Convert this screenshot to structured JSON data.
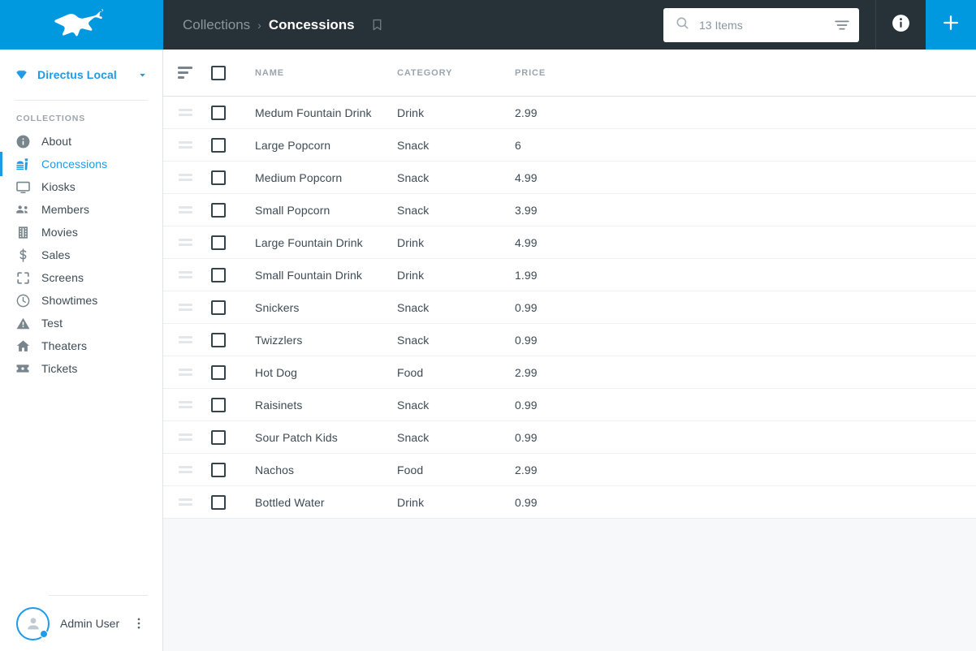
{
  "theme": {
    "brand_blue": "#0099e0",
    "accent_blue": "#1d9ae8",
    "header_dark": "#263238",
    "text_primary": "#3d4b55",
    "text_muted": "#9aa5ad",
    "page_bg": "#f7f8f9"
  },
  "sidebar": {
    "logo_icon": "directus-rabbit-logo",
    "project": {
      "icon": "gem-icon",
      "name": "Directus Local",
      "caret_icon": "chevron-down-icon"
    },
    "section_label": "COLLECTIONS",
    "items": [
      {
        "label": "About",
        "icon": "info-circle-icon",
        "active": false
      },
      {
        "label": "Concessions",
        "icon": "fastfood-icon",
        "active": true
      },
      {
        "label": "Kiosks",
        "icon": "monitor-icon",
        "active": false
      },
      {
        "label": "Members",
        "icon": "people-icon",
        "active": false
      },
      {
        "label": "Movies",
        "icon": "film-strip-icon",
        "active": false
      },
      {
        "label": "Sales",
        "icon": "dollar-sign-icon",
        "active": false
      },
      {
        "label": "Screens",
        "icon": "fullscreen-icon",
        "active": false
      },
      {
        "label": "Showtimes",
        "icon": "clock-icon",
        "active": false
      },
      {
        "label": "Test",
        "icon": "warning-triangle-icon",
        "active": false
      },
      {
        "label": "Theaters",
        "icon": "home-icon",
        "active": false
      },
      {
        "label": "Tickets",
        "icon": "ticket-icon",
        "active": false
      }
    ],
    "user": {
      "name": "Admin User",
      "avatar_icon": "person-avatar-icon",
      "status": "online",
      "menu_icon": "more-vertical-icon"
    }
  },
  "header": {
    "breadcrumb_parent": "Collections",
    "breadcrumb_separator": "›",
    "title": "Concessions",
    "bookmark_icon": "bookmark-icon",
    "search": {
      "icon": "search-icon",
      "placeholder": "13 Items",
      "value": "",
      "filter_icon": "filter-icon"
    },
    "info_button": {
      "icon": "info-icon",
      "label": "Info"
    },
    "add_button": {
      "icon": "plus-icon",
      "label": "Create Item"
    }
  },
  "table": {
    "sort_icon": "sort-icon",
    "select_all_checked": false,
    "columns": [
      {
        "key": "name",
        "label": "NAME"
      },
      {
        "key": "category",
        "label": "CATEGORY"
      },
      {
        "key": "price",
        "label": "PRICE"
      }
    ],
    "rows": [
      {
        "name": "Medum Fountain Drink",
        "category": "Drink",
        "price": "2.99"
      },
      {
        "name": "Large Popcorn",
        "category": "Snack",
        "price": "6"
      },
      {
        "name": "Medium Popcorn",
        "category": "Snack",
        "price": "4.99"
      },
      {
        "name": "Small Popcorn",
        "category": "Snack",
        "price": "3.99"
      },
      {
        "name": "Large Fountain Drink",
        "category": "Drink",
        "price": "4.99"
      },
      {
        "name": "Small Fountain Drink",
        "category": "Drink",
        "price": "1.99"
      },
      {
        "name": "Snickers",
        "category": "Snack",
        "price": "0.99"
      },
      {
        "name": "Twizzlers",
        "category": "Snack",
        "price": "0.99"
      },
      {
        "name": "Hot Dog",
        "category": "Food",
        "price": "2.99"
      },
      {
        "name": "Raisinets",
        "category": "Snack",
        "price": "0.99"
      },
      {
        "name": "Sour Patch Kids",
        "category": "Snack",
        "price": "0.99"
      },
      {
        "name": "Nachos",
        "category": "Food",
        "price": "2.99"
      },
      {
        "name": "Bottled Water",
        "category": "Drink",
        "price": "0.99"
      }
    ]
  }
}
